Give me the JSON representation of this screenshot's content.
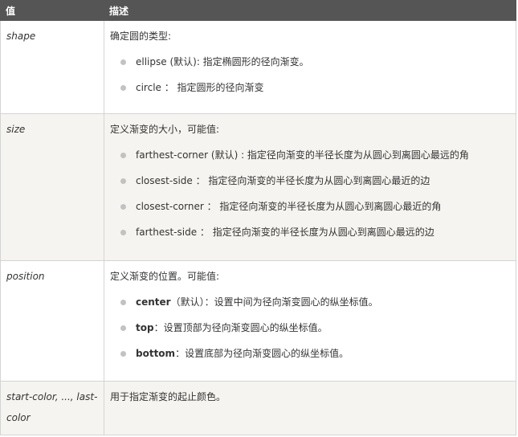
{
  "header": {
    "col_value": "值",
    "col_desc": "描述"
  },
  "rows": [
    {
      "key": "shape",
      "intro": "确定圆的类型:",
      "items": [
        {
          "strong": "",
          "text": "ellipse (默认): 指定椭圆形的径向渐变。"
        },
        {
          "strong": "",
          "text": "circle ： 指定圆形的径向渐变"
        }
      ]
    },
    {
      "key": "size",
      "intro": "定义渐变的大小，可能值:",
      "items": [
        {
          "strong": "",
          "text": "farthest-corner (默认) : 指定径向渐变的半径长度为从圆心到离圆心最远的角"
        },
        {
          "strong": "",
          "text": "closest-side ： 指定径向渐变的半径长度为从圆心到离圆心最近的边"
        },
        {
          "strong": "",
          "text": "closest-corner ：  指定径向渐变的半径长度为从圆心到离圆心最近的角"
        },
        {
          "strong": "",
          "text": "farthest-side ： 指定径向渐变的半径长度为从圆心到离圆心最远的边"
        }
      ]
    },
    {
      "key": "position",
      "intro": "定义渐变的位置。可能值:",
      "items": [
        {
          "strong": "center",
          "text": "（默认）：设置中间为径向渐变圆心的纵坐标值。"
        },
        {
          "strong": "top",
          "text": "：设置顶部为径向渐变圆心的纵坐标值。"
        },
        {
          "strong": "bottom",
          "text": "：设置底部为径向渐变圆心的纵坐标值。"
        }
      ]
    },
    {
      "key": "start-color, ..., last-color",
      "intro": "用于指定渐变的起止颜色。",
      "items": []
    }
  ]
}
